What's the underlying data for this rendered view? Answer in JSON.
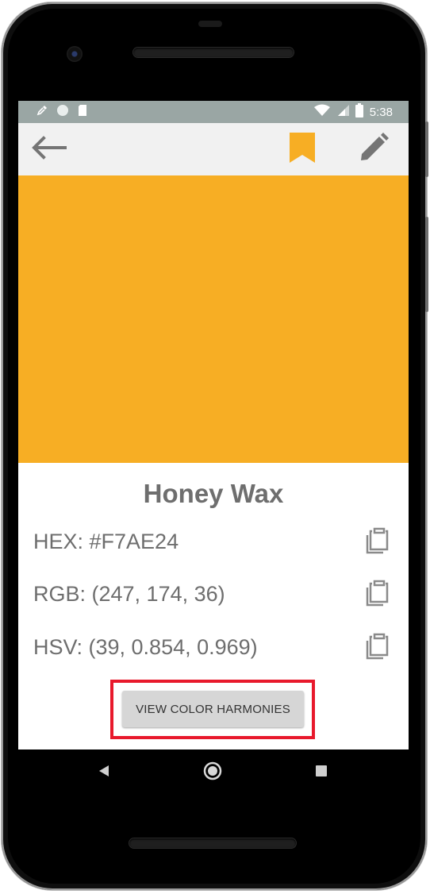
{
  "status_bar": {
    "time": "5:38",
    "icons": [
      "eyedropper-icon",
      "circle-icon",
      "sd-card-icon",
      "wifi-icon",
      "signal-icon",
      "battery-icon"
    ]
  },
  "app_bar": {
    "icons": [
      "back-arrow-icon",
      "bookmark-icon",
      "edit-pencil-icon"
    ]
  },
  "color": {
    "name": "Honey Wax",
    "swatch_hex": "#F7AE24",
    "rows": [
      {
        "text": "HEX: #F7AE24",
        "icon": "clipboard-copy-icon"
      },
      {
        "text": "RGB: (247, 174, 36)",
        "icon": "clipboard-copy-icon"
      },
      {
        "text": "HSV: (39, 0.854, 0.969)",
        "icon": "clipboard-copy-icon"
      }
    ]
  },
  "actions": {
    "harmonies_label": "VIEW COLOR HARMONIES"
  },
  "nav_bar": {
    "icons": [
      "nav-back-icon",
      "nav-home-icon",
      "nav-recents-icon"
    ]
  },
  "theme": {
    "accent": "#F7AE24",
    "bookmark": "#F7AE24",
    "highlight": "#E8192C",
    "text_gray": "#6E6E6E",
    "statusbar": "#9AA6A4",
    "appbar": "#F1F1F1"
  }
}
